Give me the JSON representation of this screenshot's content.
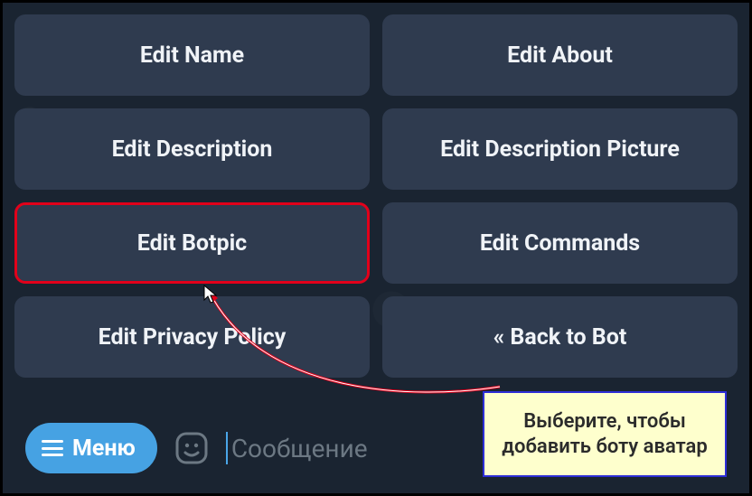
{
  "buttons": [
    {
      "label": "Edit Name",
      "highlighted": false
    },
    {
      "label": "Edit About",
      "highlighted": false
    },
    {
      "label": "Edit Description",
      "highlighted": false
    },
    {
      "label": "Edit Description Picture",
      "highlighted": false
    },
    {
      "label": "Edit Botpic",
      "highlighted": true
    },
    {
      "label": "Edit Commands",
      "highlighted": false
    },
    {
      "label": "Edit Privacy Policy",
      "highlighted": false
    },
    {
      "label": "« Back to Bot",
      "highlighted": false
    }
  ],
  "menu": {
    "label": "Меню"
  },
  "input": {
    "placeholder": "Сообщение"
  },
  "callout": {
    "text": "Выберите, чтобы добавить боту аватар"
  },
  "colors": {
    "highlight_border": "#e2001a",
    "callout_border": "#2d2ed7",
    "callout_bg": "#feffcd",
    "accent": "#46a2e3"
  }
}
